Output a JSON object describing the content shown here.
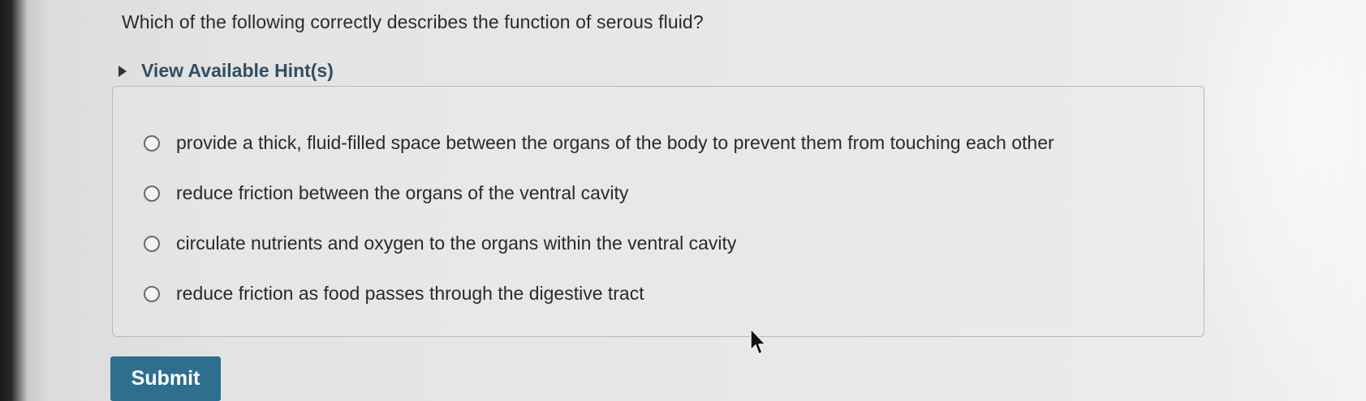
{
  "question": {
    "text": "Which of the following correctly describes the function of serous fluid?"
  },
  "hints": {
    "label": "View Available Hint(s)"
  },
  "options": [
    {
      "label": "provide a thick, fluid-filled space between the organs of the body to prevent them from touching each other",
      "selected": false
    },
    {
      "label": "reduce friction between the organs of the ventral cavity",
      "selected": false
    },
    {
      "label": "circulate nutrients and oxygen to the organs within the ventral cavity",
      "selected": false
    },
    {
      "label": "reduce friction as food passes through the digestive tract",
      "selected": false
    }
  ],
  "submit": {
    "label": "Submit"
  },
  "icons": {
    "hint_toggle": "caret-right-icon",
    "pointer": "mouse-pointer-icon"
  },
  "colors": {
    "submit_bg": "#2e6f8f",
    "hint_text": "#2f4f63"
  }
}
